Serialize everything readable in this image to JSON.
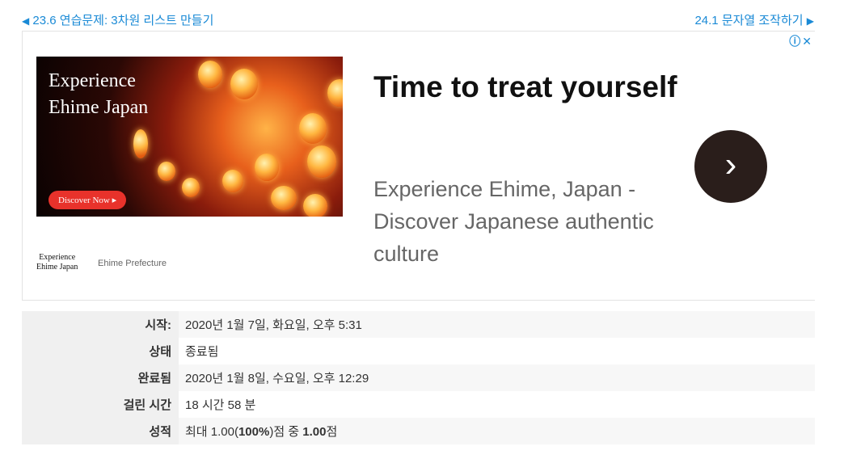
{
  "nav": {
    "prev_label": "23.6 연습문제: 3차원 리스트 만들기",
    "next_label": "24.1 문자열 조작하기"
  },
  "ad": {
    "choices_label": "ⓘ✕",
    "image_title_line1": "Experience",
    "image_title_line2": "Ehime Japan",
    "image_cta": "Discover Now ▸",
    "logo_line1": "Experience",
    "logo_line2": "Ehime Japan",
    "brand_name": "Ehime Prefecture",
    "headline": "Time to treat yourself",
    "description": "Experience Ehime, Japan - Discover Japanese authentic culture",
    "go_icon": "›"
  },
  "summary": {
    "rows": [
      {
        "label": "시작:",
        "value": "2020년 1월 7일, 화요일, 오후 5:31"
      },
      {
        "label": "상태",
        "value": "종료됨"
      },
      {
        "label": "완료됨",
        "value": "2020년 1월 8일, 수요일, 오후 12:29"
      },
      {
        "label": "걸린 시간",
        "value": "18 시간 58 분"
      }
    ],
    "grade_label": "성적",
    "grade_prefix": "최대 1.00(",
    "grade_percent": "100%",
    "grade_middle": ")점 중 ",
    "grade_score": "1.00",
    "grade_suffix": "점"
  }
}
